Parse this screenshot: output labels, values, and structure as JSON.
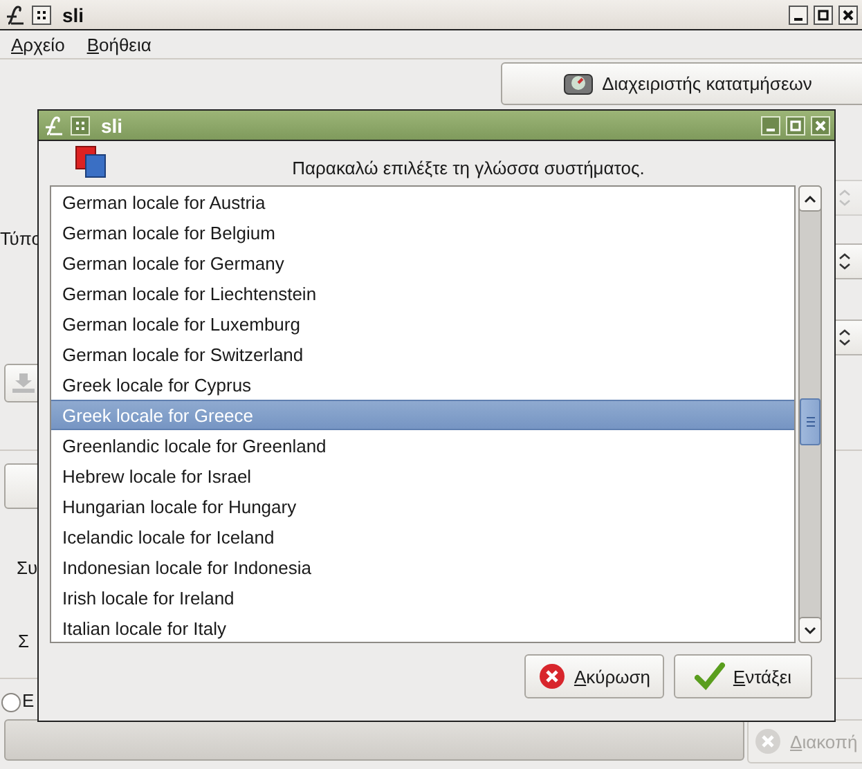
{
  "window": {
    "title": "sli"
  },
  "menu": [
    {
      "label": "Αρχείο"
    },
    {
      "label": "Βοήθεια"
    }
  ],
  "partition_button": {
    "label": "Διαχειριστής κατατμήσεων"
  },
  "background_labels": [
    {
      "text": "Τύπο"
    },
    {
      "text": "Συ"
    },
    {
      "text": "Σ"
    }
  ],
  "radio": {
    "label": "Ε",
    "selected": false
  },
  "progress": {
    "level": 0
  },
  "stop_button": {
    "label": "Διακοπή",
    "disabled": true
  },
  "dialog": {
    "title": "sli",
    "prompt": "Παρακαλώ επιλέξτε τη γλώσσα συστήματος.",
    "locales": [
      {
        "label": "German locale for Austria",
        "selected": false
      },
      {
        "label": "German locale for Belgium",
        "selected": false
      },
      {
        "label": "German locale for Germany",
        "selected": false
      },
      {
        "label": "German locale for Liechtenstein",
        "selected": false
      },
      {
        "label": "German locale for Luxemburg",
        "selected": false
      },
      {
        "label": "German locale for Switzerland",
        "selected": false
      },
      {
        "label": "Greek locale for Cyprus",
        "selected": false
      },
      {
        "label": "Greek locale for Greece",
        "selected": true
      },
      {
        "label": "Greenlandic locale for Greenland",
        "selected": false
      },
      {
        "label": "Hebrew locale for Israel",
        "selected": false
      },
      {
        "label": "Hungarian locale for Hungary",
        "selected": false
      },
      {
        "label": "Icelandic locale for Iceland",
        "selected": false
      },
      {
        "label": "Indonesian locale for Indonesia",
        "selected": false
      },
      {
        "label": "Irish locale for Ireland",
        "selected": false
      },
      {
        "label": "Italian locale for Italy",
        "selected": false
      }
    ],
    "buttons": [
      {
        "kind": "cancel",
        "label": "Ακύρωση"
      },
      {
        "kind": "ok",
        "label": "Εντάξει"
      }
    ]
  }
}
